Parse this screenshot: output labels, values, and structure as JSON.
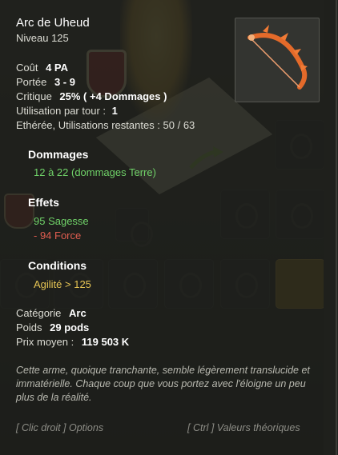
{
  "item": {
    "name": "Arc de Uheud",
    "level": "Niveau  125"
  },
  "stats": {
    "cost_label": "Coût",
    "cost_value": "4 PA",
    "range_label": "Portée",
    "range_value": "3 - 9",
    "crit_label": "Critique",
    "crit_value": "25% ( +4 Dommages )",
    "uses_label": "Utilisation par tour :",
    "uses_value": "1",
    "ethereal": "Ethérée, Utilisations restantes : 50 / 63"
  },
  "damage": {
    "heading": "Dommages",
    "value": "12 à 22 (dommages Terre)"
  },
  "effects": {
    "heading": "Effets",
    "items": [
      "95 Sagesse",
      "- 94 Force"
    ]
  },
  "conditions": {
    "heading": "Conditions",
    "value": "Agilité > 125"
  },
  "info": {
    "category_label": "Catégorie",
    "category_value": "Arc",
    "weight_label": "Poids",
    "weight_value": "29 pods",
    "price_label": "Prix moyen :",
    "price_value": "119 503 K"
  },
  "description": "Cette arme, quoique tranchante, semble légèrement translucide et immatérielle. Chaque coup que vous portez avec l'éloigne un peu plus de la réalité.",
  "hints": {
    "right_click": "[ Clic droit ] Options",
    "ctrl": "[ Ctrl ] Valeurs théoriques"
  },
  "colors": {
    "bonus": "#6fd168",
    "malus": "#e05d50",
    "condition": "#e7c554"
  },
  "icons": {
    "item": "bow-icon",
    "slots": "empty-equipment-slot-icon",
    "gold_slot": "dofus-slot-icon"
  }
}
